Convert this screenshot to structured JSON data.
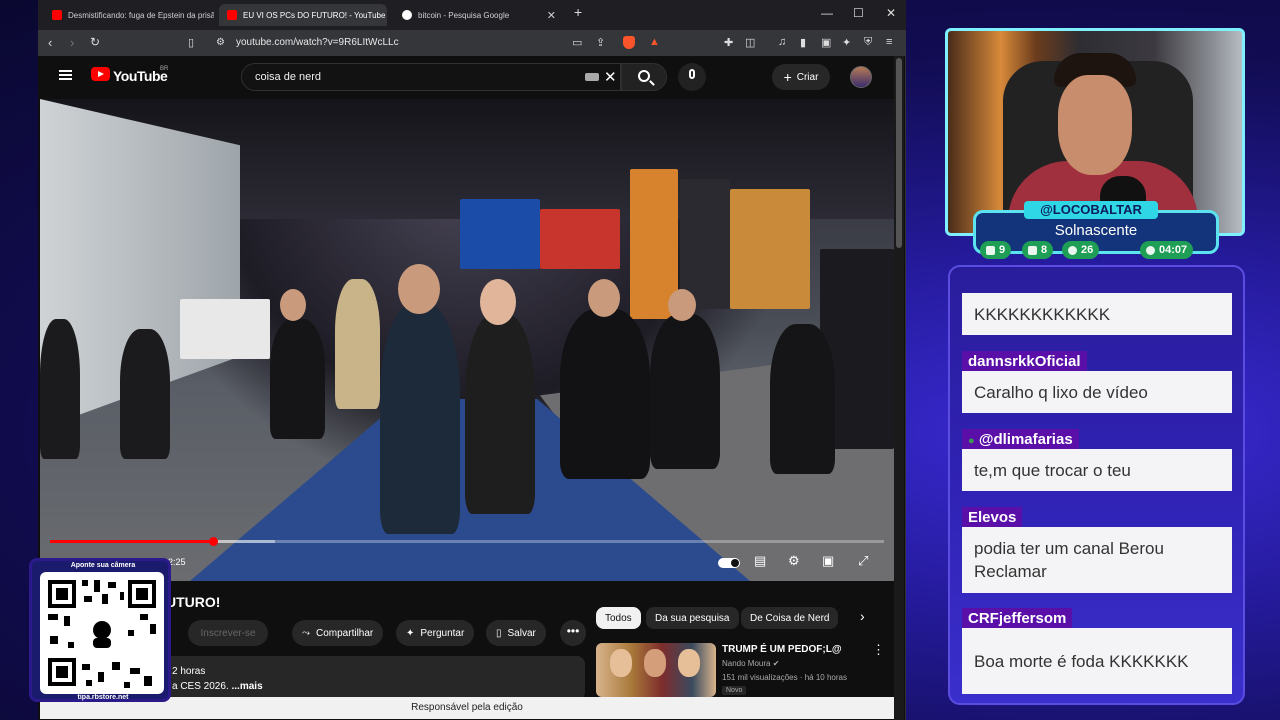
{
  "browser": {
    "tabs": [
      {
        "title": "Desmistificando: fuga de Epstein da prisão e",
        "active": false
      },
      {
        "title": "EU VI OS PCs DO FUTURO! - YouTube",
        "active": true
      },
      {
        "title": "bitcoin - Pesquisa Google",
        "active": false
      }
    ],
    "new_tab": "+",
    "url": "youtube.com/watch?v=9R6LItWcLLc",
    "badge_count": "37"
  },
  "youtube": {
    "logo": "YouTube",
    "region": "BR",
    "search_query": "coisa de nerd",
    "create_label": "Criar",
    "video": {
      "time": "2:25",
      "progress": 0.195,
      "buffered": 0.27
    },
    "title": "UTURO!",
    "subscribe_label": "Inscrever-se",
    "actions": {
      "share": "Compartilhar",
      "ask": "Perguntar",
      "save": "Salvar"
    },
    "description": {
      "line1": "2 horas",
      "line2": "a CES 2026.",
      "more": " ...mais"
    },
    "chips": [
      "Todos",
      "Da sua pesquisa",
      "De Coisa de Nerd"
    ],
    "recommendation": {
      "title": "TRUMP É UM PEDOF;L@",
      "channel": "Nando Moura",
      "views": "151 mil visualizações",
      "age": "há 10 horas",
      "badge": "Novo"
    },
    "status_text": "Responsável pela edição"
  },
  "qr": {
    "header": "Aponte sua câmera",
    "footer": "tipa.rbstore.net"
  },
  "stream": {
    "handle": "@LOCOBALTAR",
    "game": "Solnascente",
    "stats": [
      {
        "icon": "chat-icon",
        "value": "9",
        "color": "#1f9e55"
      },
      {
        "icon": "video-icon",
        "value": "8",
        "color": "#1f9e55"
      },
      {
        "icon": "gift-icon",
        "value": "26",
        "color": "#1f9e55"
      },
      {
        "icon": "clock-icon",
        "value": "04:07",
        "color": "#1f9e55"
      }
    ]
  },
  "chat": {
    "messages": [
      {
        "user": "",
        "text": "KKKKKKKKKKKK"
      },
      {
        "user": "dannsrkkOficial",
        "text": "Caralho q lixo de vídeo"
      },
      {
        "user": "@dlimafarias",
        "text": "te,m que trocar o teu"
      },
      {
        "user": "Elevos",
        "text": "podia ter um canal Berou Reclamar"
      },
      {
        "user": "CRFjeffersom",
        "text": "Boa morte é foda KKKKKKK"
      }
    ]
  },
  "colors": {
    "youtube_red": "#ff0000",
    "chat_name_bg": "#5a0fa8",
    "accent_cyan": "#2fd6e6"
  }
}
